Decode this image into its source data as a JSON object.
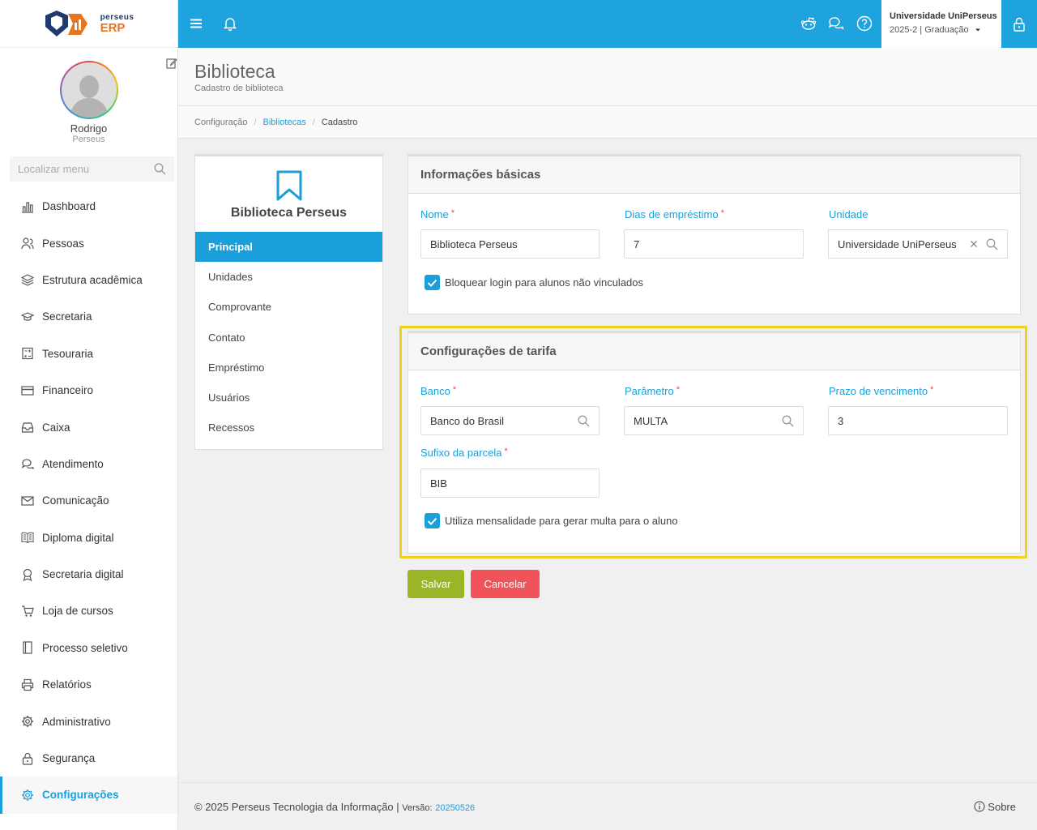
{
  "app": {
    "logo_small": "perseus",
    "logo_big": "ERP"
  },
  "profile": {
    "name": "Rodrigo",
    "subtitle": "Perseus"
  },
  "sidebar": {
    "search_placeholder": "Localizar menu",
    "items": [
      {
        "label": "Dashboard",
        "icon": "chart-icon"
      },
      {
        "label": "Pessoas",
        "icon": "people-icon"
      },
      {
        "label": "Estrutura acadêmica",
        "icon": "layers-icon"
      },
      {
        "label": "Secretaria",
        "icon": "graduation-icon"
      },
      {
        "label": "Tesouraria",
        "icon": "calculator-icon"
      },
      {
        "label": "Financeiro",
        "icon": "credit-card-icon"
      },
      {
        "label": "Caixa",
        "icon": "inbox-icon"
      },
      {
        "label": "Atendimento",
        "icon": "chat-icon"
      },
      {
        "label": "Comunicação",
        "icon": "mail-icon"
      },
      {
        "label": "Diploma digital",
        "icon": "book-icon"
      },
      {
        "label": "Secretaria digital",
        "icon": "award-icon"
      },
      {
        "label": "Loja de cursos",
        "icon": "cart-icon"
      },
      {
        "label": "Processo seletivo",
        "icon": "notebook-icon"
      },
      {
        "label": "Relatórios",
        "icon": "printer-icon"
      },
      {
        "label": "Administrativo",
        "icon": "gear-icon"
      },
      {
        "label": "Segurança",
        "icon": "lock-icon"
      },
      {
        "label": "Configurações",
        "icon": "settings-icon",
        "active": true
      }
    ]
  },
  "topbar": {
    "university": "Universidade UniPerseus",
    "period": "2025-2 | Graduação",
    "color": "#1fa3de"
  },
  "header": {
    "title": "Biblioteca",
    "subtitle": "Cadastro de biblioteca"
  },
  "breadcrumb": {
    "items": [
      "Configuração",
      "Bibliotecas",
      "Cadastro"
    ]
  },
  "library_card": {
    "name": "Biblioteca Perseus",
    "tabs": [
      "Principal",
      "Unidades",
      "Comprovante",
      "Contato",
      "Empréstimo",
      "Usuários",
      "Recessos"
    ]
  },
  "basic_info": {
    "title": "Informações básicas",
    "nome_label": "Nome",
    "nome_value": "Biblioteca Perseus",
    "dias_label": "Dias de empréstimo",
    "dias_value": "7",
    "unidade_label": "Unidade",
    "unidade_value": "Universidade UniPerseus",
    "checkbox_label": "Bloquear login para alunos não vinculados",
    "required_mark": "*"
  },
  "tariff": {
    "title": "Configurações de tarifa",
    "banco_label": "Banco",
    "banco_value": "Banco do Brasil",
    "parametro_label": "Parâmetro",
    "parametro_value": "MULTA",
    "prazo_label": "Prazo de vencimento",
    "prazo_value": "3",
    "sufixo_label": "Sufixo da parcela",
    "sufixo_value": "BIB",
    "checkbox_label": "Utiliza mensalidade para gerar multa para o aluno"
  },
  "actions": {
    "save": "Salvar",
    "cancel": "Cancelar"
  },
  "footer": {
    "copyright": "© 2025 Perseus Tecnologia da Informação",
    "version_label": "Versão:",
    "version": "20250526",
    "about": "Sobre"
  }
}
